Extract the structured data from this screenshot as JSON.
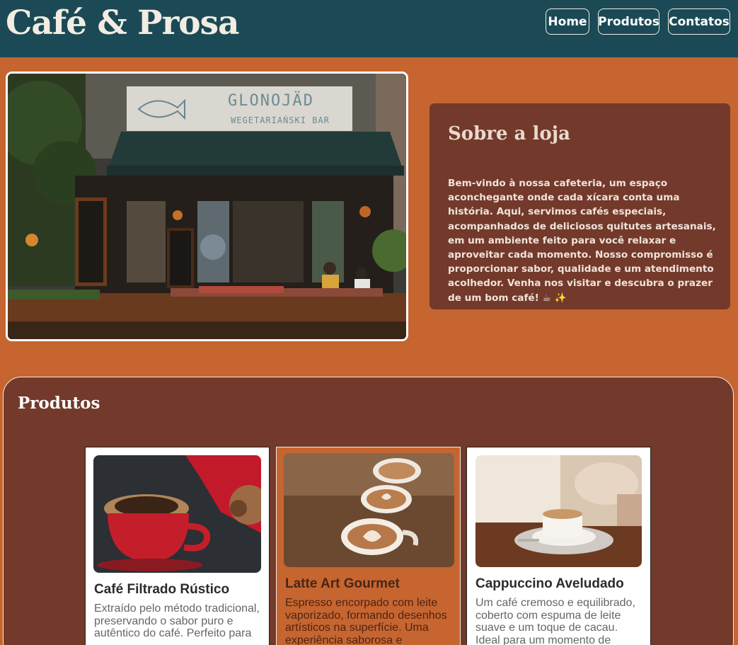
{
  "header": {
    "brand": "Café & Prosa",
    "nav": [
      "Home",
      "Produtos",
      "Contatos"
    ]
  },
  "hero": {
    "sign_title": "GLONOJÄD",
    "sign_subtitle": "WEGETARIAŃSKI BAR"
  },
  "about": {
    "title": "Sobre a loja",
    "text": "Bem-vindo à nossa cafeteria, um espaço aconchegante onde cada xícara conta uma história. Aqui, servimos cafés especiais, acompanhados de deliciosos quitutes artesanais, em um ambiente feito para você relaxar e aproveitar cada momento. Nosso compromisso é proporcionar sabor, qualidade e um atendimento acolhedor. Venha nos visitar e descubra o prazer de um bom café! ☕ ✨"
  },
  "products": {
    "title": "Produtos",
    "items": [
      {
        "name": "Café Filtrado Rústico",
        "description": "Extraído pelo método tradicional, preservando o sabor puro e autêntico do café. Perfeito para"
      },
      {
        "name": "Latte Art Gourmet",
        "description": "Espresso encorpado com leite vaporizado, formando desenhos artísticos na superfície. Uma experiência saborosa e"
      },
      {
        "name": "Cappuccino Aveludado",
        "description": "Um café cremoso e equilibrado, coberto com espuma de leite suave e um toque de cacau. Ideal para um momento de"
      }
    ]
  },
  "colors": {
    "header": "#1b4a56",
    "page": "#c66530",
    "panel": "#73392a"
  }
}
